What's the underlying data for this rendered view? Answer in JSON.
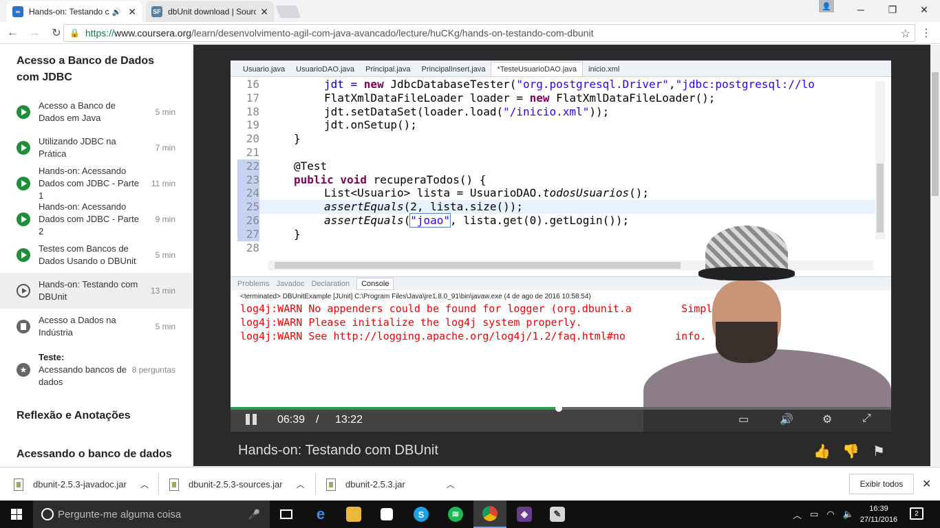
{
  "browser": {
    "tabs": [
      {
        "title": "Hands-on: Testando c",
        "favicon": "coursera-icon",
        "active": true
      },
      {
        "title": "dbUnit download | Sourc",
        "favicon": "sourceforge-icon",
        "active": false
      }
    ],
    "favicon_text": {
      "coursera": "∞",
      "sourceforge": "SF"
    },
    "url_scheme": "https://",
    "url_domain": "www.coursera.org",
    "url_path": "/learn/desenvolvimento-agil-com-java-avancado/lecture/huCKg/hands-on-testando-com-dbunit"
  },
  "sidebar": {
    "heading1": "Acesso a Banco de Dados com JDBC",
    "items": [
      {
        "label": "Acesso a Banco de Dados em Java",
        "duration": "5 min",
        "icon": "completed-video-icon"
      },
      {
        "label": "Utilizando JDBC na Prática",
        "duration": "7 min",
        "icon": "completed-video-icon"
      },
      {
        "label": "Hands-on: Acessando Dados com JDBC - Parte 1",
        "duration": "11 min",
        "icon": "completed-video-icon"
      },
      {
        "label": "Hands-on: Acessando Dados com JDBC - Parte 2",
        "duration": "9 min",
        "icon": "completed-video-icon"
      },
      {
        "label": "Testes com Bancos de Dados Usando o DBUnit",
        "duration": "5 min",
        "icon": "completed-video-icon"
      },
      {
        "label": "Hands-on: Testando com DBUnit",
        "duration": "13 min",
        "icon": "play-video-icon"
      },
      {
        "label": "Acesso a Dados na Indústria",
        "duration": "5 min",
        "icon": "reading-icon"
      }
    ],
    "quiz": {
      "title": "Teste:",
      "label": "Acessando bancos de dados",
      "count": "8 perguntas"
    },
    "heading2": "Reflexão e Anotações",
    "heading3": "Acessando o banco de dados"
  },
  "editor": {
    "tabs": [
      "Usuario.java",
      "UsuarioDAO.java",
      "Principal.java",
      "PrincipalInsert.java",
      "*TesteUsuarioDAO.java",
      "inicio.xml"
    ],
    "line_numbers": [
      "16",
      "17",
      "18",
      "19",
      "20",
      "21",
      "22",
      "23",
      "24",
      "25",
      "26",
      "27",
      "28"
    ],
    "line_numbers_note": "rendered from line_numbers",
    "code": {
      "l16a": "jdt = ",
      "l16b": "new",
      "l16c": " JdbcDatabaseTester(",
      "l16d": "\"org.postgresql.Driver\"",
      "l16e": ",",
      "l16f": "\"jdbc:postgresql://lo",
      "l17": "FlatXmlDataFileLoader loader = ",
      "l17kw": "new",
      "l17b": " FlatXmlDataFileLoader();",
      "l18a": "jdt.setDataSet(loader.load(",
      "l18b": "\"/inicio.xml\"",
      "l18c": "));",
      "l19": "jdt.onSetup();",
      "l20": "}",
      "l22": "@Test",
      "l23kw": "public void",
      "l23b": " recuperaTodos() {",
      "l24a": "List<Usuario> lista = UsuarioDAO.",
      "l24b": "todosUsuarios",
      "l24c": "();",
      "l25a": "assertEquals",
      "l25b": "(2, lista.size());",
      "l26a": "assertEquals",
      "l26b": "(",
      "l26c": "\"joao\"",
      "l26d": ", lista.get(0).getLogin());",
      "l27": "}"
    },
    "console_tabs": [
      "Problems",
      "Javadoc",
      "Declaration",
      "Console"
    ],
    "console_header": "<terminated> DBUnitExample [JUnit] C:\\Program Files\\Java\\jre1.8.0_91\\bin\\javaw.exe (4 de ago de 2016 10:58:54)",
    "console_lines": [
      "log4j:WARN No appenders could be found for logger (org.dbunit.a        SimpleAssert).",
      "log4j:WARN Please initialize the log4j system properly.",
      "log4j:WARN See http://logging.apache.org/log4j/1.2/faq.html#no        info."
    ]
  },
  "player": {
    "current_time": "06:39",
    "separator": "/",
    "total_time": "13:22",
    "progress": 0.497,
    "title": "Hands-on: Testando com DBUnit"
  },
  "downloads": {
    "files": [
      "dbunit-2.5.3-javadoc.jar",
      "dbunit-2.5.3-sources.jar",
      "dbunit-2.5.3.jar"
    ],
    "show_all": "Exibir todos"
  },
  "taskbar": {
    "search_placeholder": "Pergunte-me alguma coisa",
    "time": "16:39",
    "date": "27/11/2016",
    "notif_count": "2"
  },
  "colors": {
    "accent_green": "#1f8d3a",
    "url_green": "#0b8043",
    "java_keyword": "#7f0055",
    "java_string": "#2a00ff",
    "console_error": "#ee0000"
  }
}
